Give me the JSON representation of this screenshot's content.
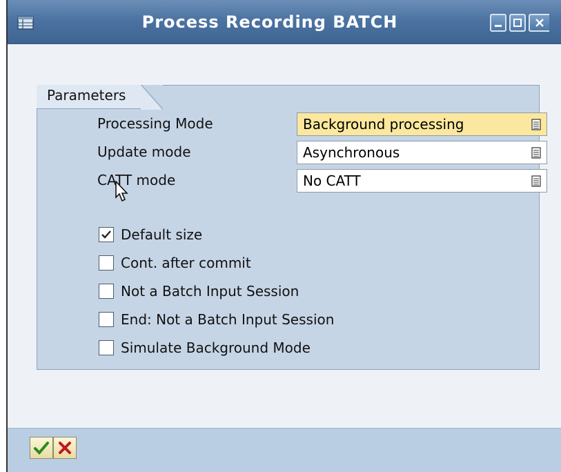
{
  "window": {
    "title": "Process Recording BATCH",
    "controls": [
      "minimize-icon",
      "maximize-icon",
      "close-icon"
    ]
  },
  "parameters": {
    "group_title": "Parameters",
    "fields": [
      {
        "label": "Processing Mode",
        "value": "Background processing",
        "focused": true
      },
      {
        "label": "Update mode",
        "value": "Asynchronous",
        "focused": false
      },
      {
        "label": "CATT mode",
        "value": "No CATT",
        "focused": false
      }
    ],
    "checkboxes": [
      {
        "label": "Default size",
        "checked": true
      },
      {
        "label": "Cont. after commit",
        "checked": false
      },
      {
        "label": "Not a Batch Input Session",
        "checked": false
      },
      {
        "label": "End: Not a Batch Input Session",
        "checked": false
      },
      {
        "label": "Simulate Background Mode",
        "checked": false
      }
    ]
  },
  "footer": {
    "buttons": [
      {
        "icon": "checkmark-icon",
        "color": "#2a8a1c"
      },
      {
        "icon": "cancel-x-icon",
        "color": "#c4161c"
      }
    ]
  },
  "colors": {
    "title_bar": "#4c73a1",
    "group_background": "#c6d5e6",
    "focused_field": "#fbe89e",
    "footer": "#b9cde3"
  }
}
